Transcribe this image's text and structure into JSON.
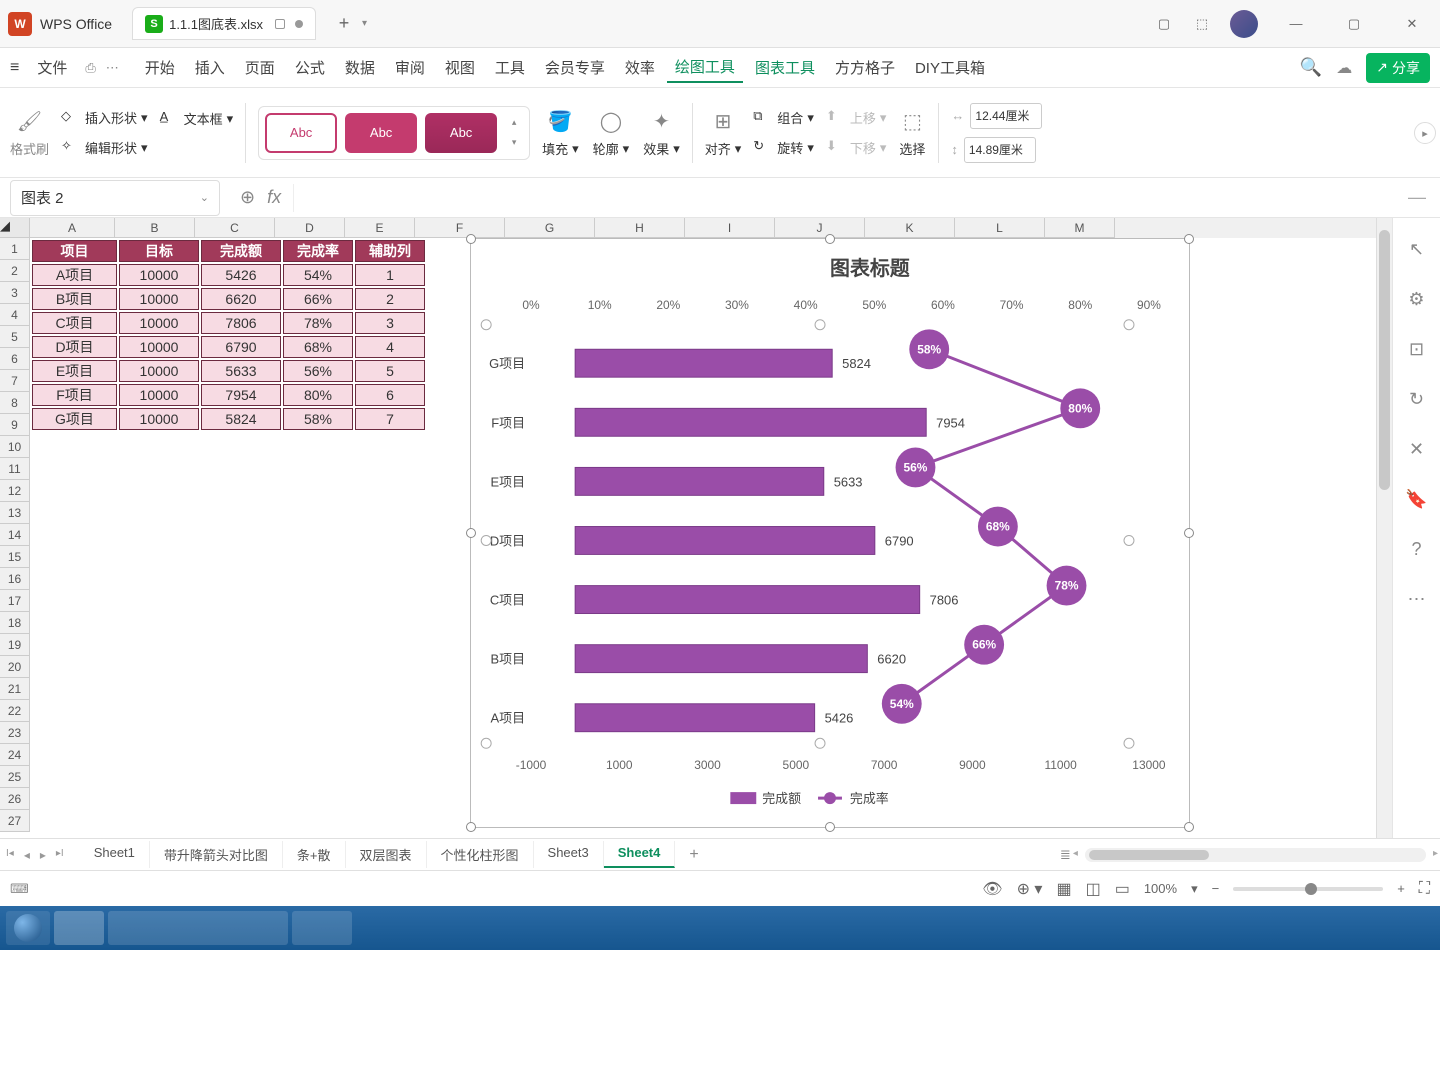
{
  "app": {
    "name": "WPS Office",
    "file_tab": "1.1.1图底表.xlsx"
  },
  "menu": {
    "file": "文件",
    "items": [
      "开始",
      "插入",
      "页面",
      "公式",
      "数据",
      "审阅",
      "视图",
      "工具",
      "会员专享",
      "效率",
      "绘图工具",
      "图表工具",
      "方方格子",
      "DIY工具箱"
    ],
    "active": "绘图工具",
    "share": "分享"
  },
  "ribbon": {
    "format_painter": "格式刷",
    "insert_shape": "插入形状",
    "edit_shape": "编辑形状",
    "text_box": "文本框",
    "style_label": "Abc",
    "fill": "填充",
    "outline": "轮廓",
    "effects": "效果",
    "align": "对齐",
    "group": "组合",
    "rotate": "旋转",
    "bring_forward": "上移",
    "send_backward": "下移",
    "select": "选择",
    "width": "12.44厘米",
    "height": "14.89厘米"
  },
  "name_box": "图表 2",
  "columns": [
    "A",
    "B",
    "C",
    "D",
    "E",
    "F",
    "G",
    "H",
    "I",
    "J",
    "K",
    "L",
    "M"
  ],
  "row_count": 27,
  "table": {
    "headers": [
      "项目",
      "目标",
      "完成额",
      "完成率",
      "辅助列"
    ],
    "rows": [
      [
        "A项目",
        "10000",
        "5426",
        "54%",
        "1"
      ],
      [
        "B项目",
        "10000",
        "6620",
        "66%",
        "2"
      ],
      [
        "C项目",
        "10000",
        "7806",
        "78%",
        "3"
      ],
      [
        "D项目",
        "10000",
        "6790",
        "68%",
        "4"
      ],
      [
        "E项目",
        "10000",
        "5633",
        "56%",
        "5"
      ],
      [
        "F项目",
        "10000",
        "7954",
        "80%",
        "6"
      ],
      [
        "G项目",
        "10000",
        "5824",
        "58%",
        "7"
      ]
    ]
  },
  "chart_data": {
    "type": "bar",
    "title": "图表标题",
    "categories": [
      "A项目",
      "B项目",
      "C项目",
      "D项目",
      "E项目",
      "F项目",
      "G项目"
    ],
    "series": [
      {
        "name": "完成额",
        "values": [
          5426,
          6620,
          7806,
          6790,
          5633,
          7954,
          5824
        ]
      },
      {
        "name": "完成率",
        "values": [
          0.54,
          0.66,
          0.78,
          0.68,
          0.56,
          0.8,
          0.58
        ]
      }
    ],
    "primary_axis": {
      "label": "",
      "min": -1000,
      "max": 13000,
      "ticks": [
        -1000,
        1000,
        3000,
        5000,
        7000,
        9000,
        11000,
        13000
      ]
    },
    "secondary_axis": {
      "label": "",
      "min": 0,
      "max": 0.9,
      "ticks": [
        0,
        0.1,
        0.2,
        0.3,
        0.4,
        0.5,
        0.6,
        0.7,
        0.8,
        0.9
      ]
    },
    "legend": [
      "完成额",
      "完成率"
    ]
  },
  "sheet_tabs": [
    "Sheet1",
    "带升降箭头对比图",
    "条+散",
    "双层图表",
    "个性化柱形图",
    "Sheet3",
    "Sheet4"
  ],
  "active_sheet": "Sheet4",
  "zoom": "100%"
}
